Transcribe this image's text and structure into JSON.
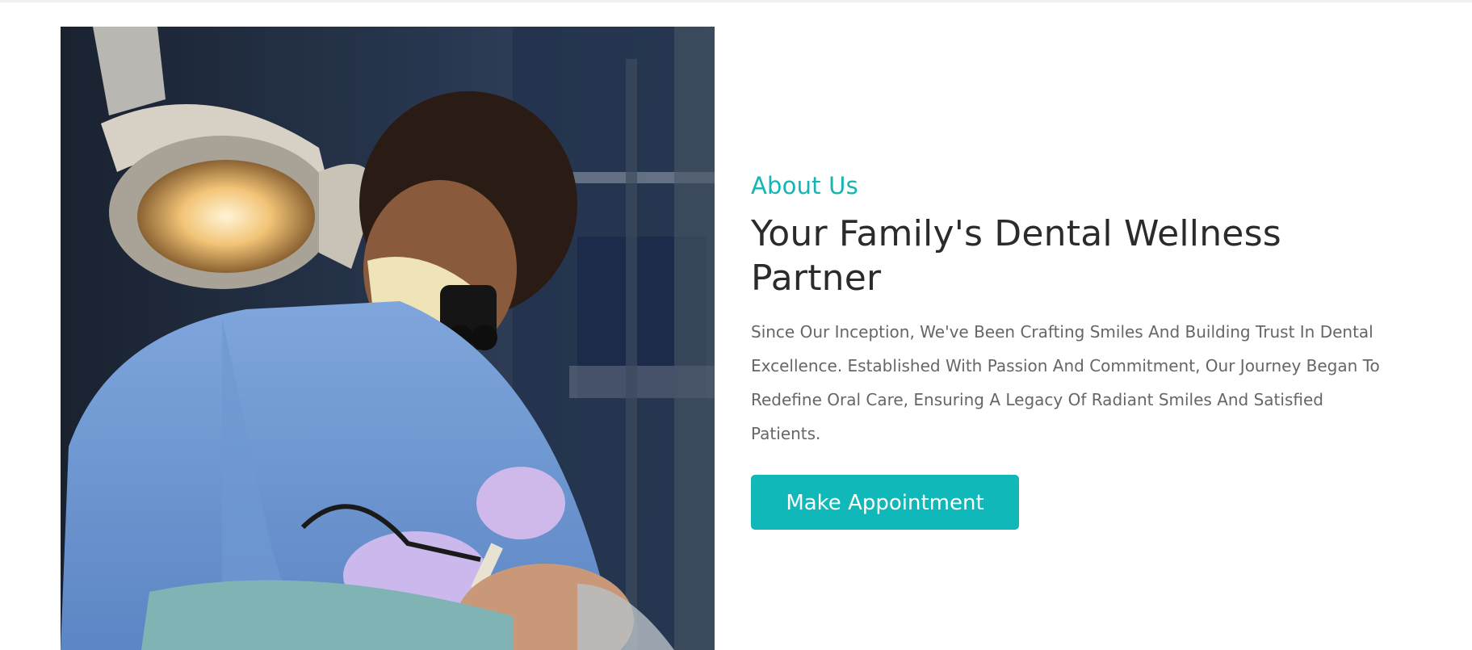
{
  "about": {
    "eyebrow": "About Us",
    "headline": "Your Family's Dental Wellness Partner",
    "body": "Since Our Inception, We've Been Crafting Smiles And Building Trust In Dental Excellence. Established With Passion And Commitment, Our Journey Began To Redefine Oral Care, Ensuring A Legacy Of Radiant Smiles And Satisfied Patients.",
    "cta_label": "Make Appointment"
  },
  "colors": {
    "accent": "#10b8b9",
    "heading": "#2b2b2b",
    "body": "#666666"
  }
}
